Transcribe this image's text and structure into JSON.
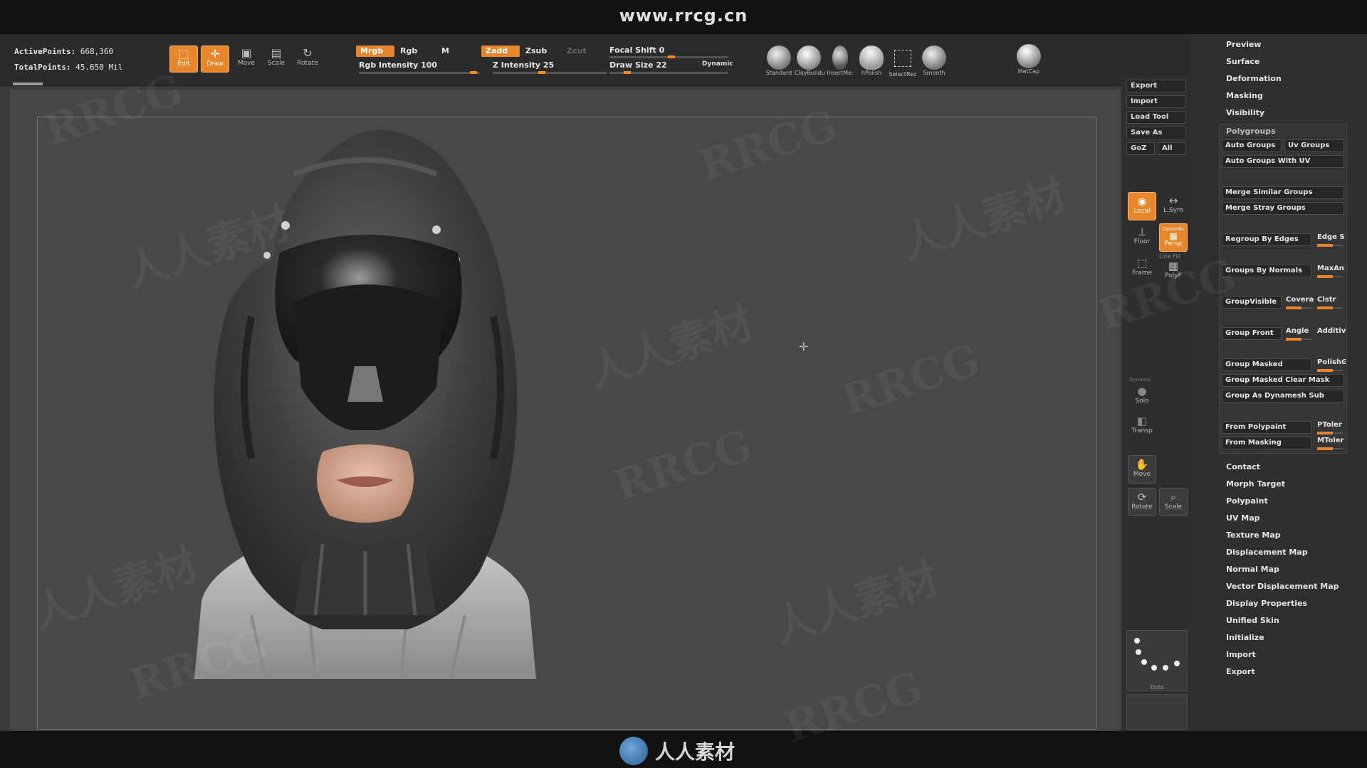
{
  "banner": {
    "site": "www.rrcg.cn"
  },
  "stats": {
    "active_label": "ActivePoints:",
    "active_value": "668,360",
    "total_label": "TotalPoints:",
    "total_value": "45.650 Mil"
  },
  "tools": [
    {
      "label": "Edit",
      "active": true
    },
    {
      "label": "Draw",
      "active": true
    },
    {
      "label": "Move",
      "active": false
    },
    {
      "label": "Scale",
      "active": false
    },
    {
      "label": "Rotate",
      "active": false
    }
  ],
  "modes": {
    "mrgb": "Mrgb",
    "rgb": "Rgb",
    "m": "M",
    "zadd": "Zadd",
    "zsub": "Zsub",
    "zcut": "Zcut",
    "rgb_intensity": "Rgb Intensity 100",
    "z_intensity": "Z Intensity 25",
    "rgb_intensity_value": 100,
    "z_intensity_value": 25
  },
  "brush": {
    "focal": "Focal Shift 0",
    "draw_size": "Draw Size 22",
    "dynamic": "Dynamic",
    "focal_value": 0,
    "draw_size_value": 22
  },
  "brushes": [
    "Standard",
    "ClayBuildu",
    "InsertMe:",
    "hPolish",
    "SelectRec",
    "Smooth"
  ],
  "matcap": "MatCap",
  "file_buttons": {
    "export": "Export",
    "import": "Import",
    "load_tool": "Load Tool",
    "save_as": "Save As",
    "goz": "GoZ",
    "all": "All"
  },
  "view_buttons": {
    "local": "Local",
    "lsym": "L.Sym",
    "floor": "Floor",
    "persp": "Persp",
    "dynamic": "Dynamic",
    "frame": "Frame",
    "polyf": "PolyF",
    "line_fill": "Line Fill",
    "solo_dynamic": "Dynamic",
    "solo": "Solo",
    "transp": "Transp",
    "move": "Move",
    "rotate": "Rotate",
    "scale": "Scale",
    "dots": "Dots"
  },
  "menu_top": [
    "Preview",
    "Surface",
    "Deformation",
    "Masking",
    "Visibility"
  ],
  "polygroups": {
    "title": "Polygroups",
    "auto_groups": "Auto Groups",
    "uv_groups": "Uv Groups",
    "auto_groups_uv": "Auto Groups With UV",
    "merge_similar": "Merge Similar Groups",
    "merge_stray": "Merge Stray Groups",
    "regroup_edges": "Regroup By Edges",
    "edge_s": "Edge S",
    "groups_normals": "Groups By Normals",
    "maxang": "MaxAn",
    "group_visible": "GroupVisible",
    "covera": "Covera",
    "clstr": "Clstr",
    "group_front": "Group Front",
    "angle": "Angle",
    "additiv": "Additiv",
    "group_masked": "Group Masked",
    "polishg": "PolishG",
    "group_masked_clear": "Group Masked Clear Mask",
    "group_dynamesh": "Group As Dynamesh Sub",
    "from_polypaint": "From Polypaint",
    "ptoler": "PToler",
    "from_masking": "From Masking",
    "mtoler": "MToler"
  },
  "menu_bottom": [
    "Contact",
    "Morph Target",
    "Polypaint",
    "UV Map",
    "Texture Map",
    "Displacement Map",
    "Normal Map",
    "Vector Displacement Map",
    "Display Properties",
    "Unified Skin",
    "Initialize",
    "Import",
    "Export"
  ],
  "footer": {
    "logo_text": "人人素材"
  },
  "watermarks": {
    "rrcg": "RRCG",
    "cn": "人人素材"
  }
}
